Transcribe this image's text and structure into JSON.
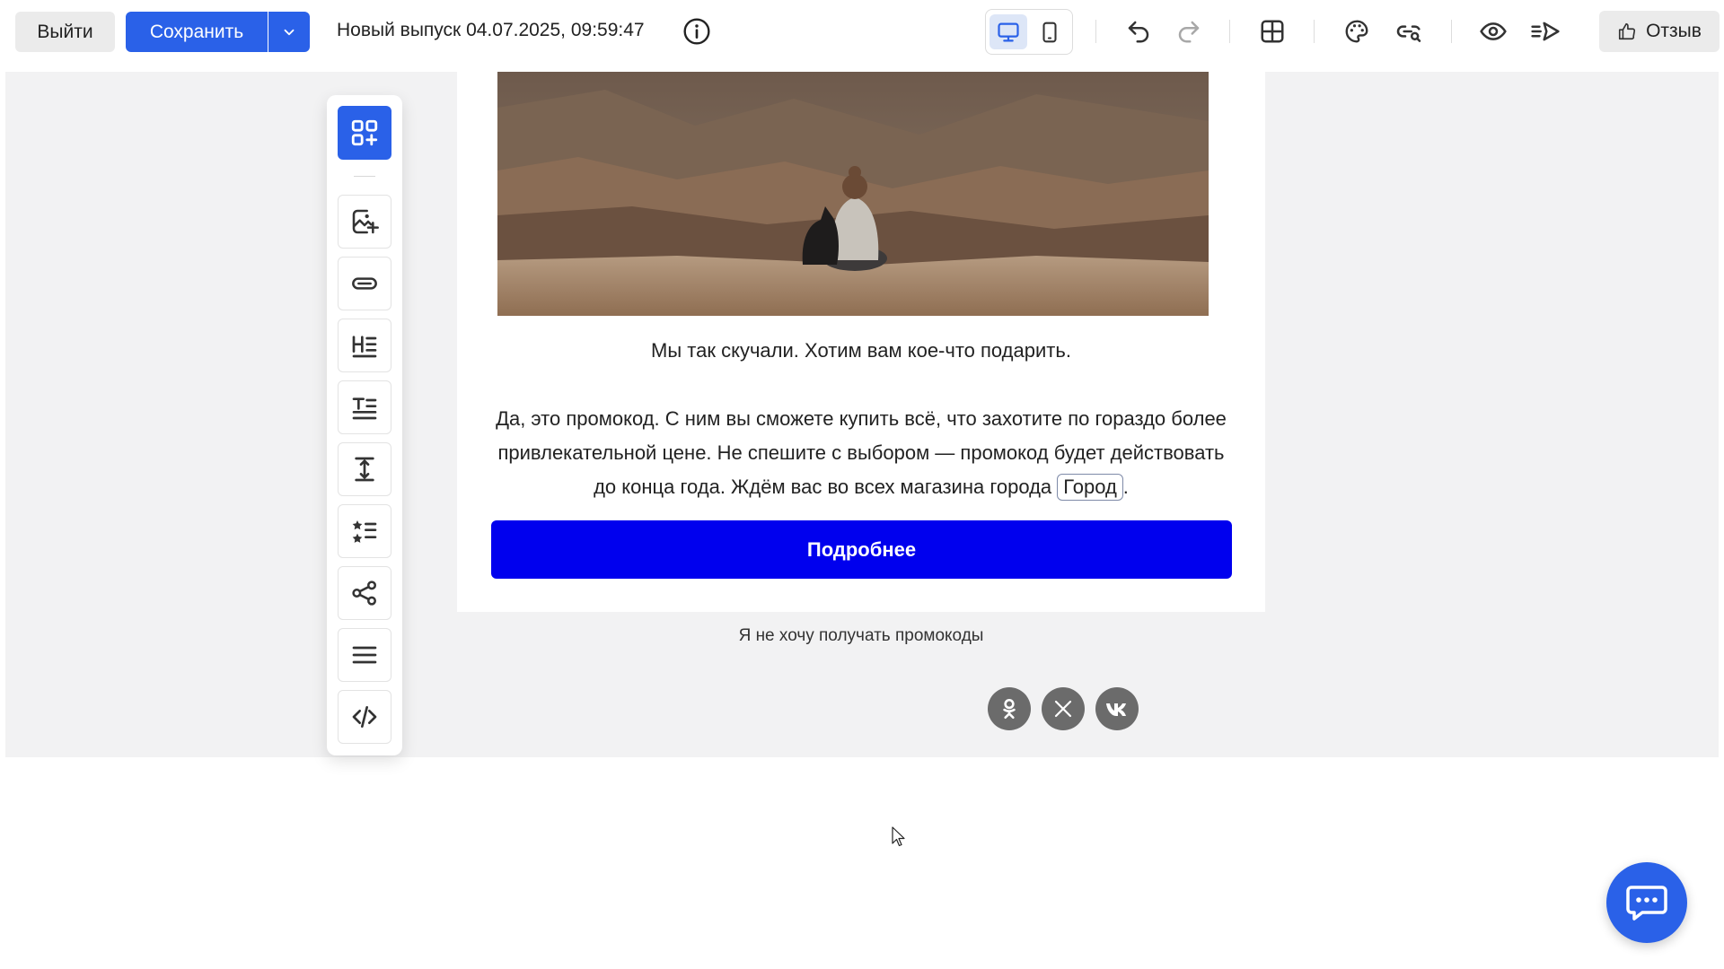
{
  "toolbar": {
    "exit_label": "Выйти",
    "save_label": "Сохранить",
    "issue_title": "Новый выпуск 04.07.2025, 09:59:47",
    "feedback_label": "Отзыв"
  },
  "icons": {
    "info": "info-icon",
    "desktop": "desktop-icon",
    "mobile": "mobile-icon",
    "undo": "undo-icon",
    "redo": "redo-icon",
    "grid": "grid-icon",
    "palette": "palette-icon",
    "link_search": "link-search-icon",
    "preview": "eye-icon",
    "send": "send-icon",
    "thumb": "thumbs-up-icon",
    "chat": "chat-icon"
  },
  "palette": {
    "items": [
      "add-block",
      "image",
      "button",
      "heading",
      "text",
      "spacer",
      "list",
      "social",
      "menu",
      "html"
    ]
  },
  "email": {
    "caption": "Мы так скучали. Хотим вам кое-что подарить.",
    "body_text": "Да, это промокод. С ним вы сможете купить всё, что захотите по гораздо более привлекательной цене. Не спешите с выбором — промокод будет действовать до конца года. Ждём вас во всех магазина города ",
    "city_variable": "Город",
    "body_tail": ".",
    "cta_label": "Подробнее",
    "unsubscribe": "Я не хочу получать промокоды"
  },
  "socials": [
    {
      "id": "ok",
      "label": "ok-icon"
    },
    {
      "id": "x",
      "label": "x-icon"
    },
    {
      "id": "vk",
      "label": "vk-icon"
    }
  ],
  "colors": {
    "accent": "#2a61e8",
    "cta": "#0000ee",
    "canvas": "#f2f2f3"
  }
}
